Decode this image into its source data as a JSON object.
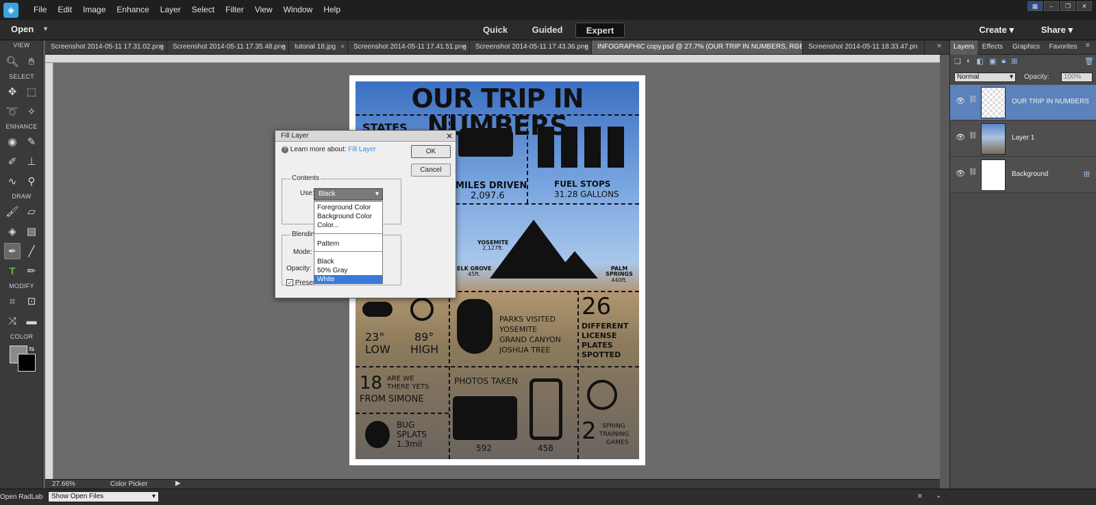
{
  "menubar": {
    "items": [
      "File",
      "Edit",
      "Image",
      "Enhance",
      "Layer",
      "Select",
      "Filter",
      "View",
      "Window",
      "Help"
    ]
  },
  "modebar": {
    "open_label": "Open",
    "modes": [
      "Quick",
      "Guided",
      "Expert"
    ],
    "create_label": "Create",
    "share_label": "Share"
  },
  "toolbox": {
    "sections": [
      "VIEW",
      "SELECT",
      "ENHANCE",
      "DRAW",
      "MODIFY",
      "COLOR"
    ]
  },
  "tabs": [
    "Screenshot 2014-05-11 17.31.02.png",
    "Screenshot 2014-05-11 17.35.48.png",
    "tutorial 18.jpg",
    "Screenshot 2014-05-11 17.41.51.png",
    "Screenshot 2014-05-11 17.43.36.png",
    "INFOGRAPHIC copy.psd @ 27.7% (OUR TRIP IN NUMBERS, RGB/8) *",
    "Screenshot 2014-05-11 18.33.47.pn"
  ],
  "artwork": {
    "title": "OUR TRIP IN NUMBERS",
    "states_label": "STATES",
    "miles_label": "MILES DRIVEN",
    "miles_value": "2,097.6",
    "fuel_label": "FUEL STOPS",
    "fuel_value": "31.28 GALLONS",
    "yosemite": "YOSEMITE",
    "yosemite_elev": "2,127ft.",
    "elk_grove": "ELK GROVE",
    "elk_elev": "45ft.",
    "palm_springs": "PALM SPRINGS",
    "palm_elev": "440ft.",
    "low_temp": "23°",
    "low_label": "LOW",
    "high_temp": "89°",
    "high_label": "HIGH",
    "parks_lines": [
      "PARKS VISITED",
      "YOSEMITE",
      "GRAND CANYON",
      "JOSHUA TREE"
    ],
    "plates_num": "26",
    "plates_lines": [
      "DIFFERENT",
      "LICENSE",
      "PLATES",
      "SPOTTED"
    ],
    "are_we_num": "18",
    "are_we_line1": "ARE WE",
    "are_we_line2": "THERE YETS",
    "are_we_line3": "FROM SIMONE",
    "photos_label": "PHOTOS TAKEN",
    "camera_count": "592",
    "phone_count": "458",
    "bug_lines": [
      "BUG",
      "SPLATS",
      "1.3mil"
    ],
    "spring_num": "2",
    "spring_lines": [
      "SPRING",
      "TRAINING",
      "GAMES"
    ]
  },
  "dialog": {
    "title": "Fill Layer",
    "learn_prefix": "Learn more about:",
    "learn_link": "Fill Layer",
    "ok_label": "OK",
    "cancel_label": "Cancel",
    "contents_label": "Contents",
    "use_label": "Use:",
    "use_value": "Black",
    "blending_label": "Blendin",
    "mode_label": "Mode:",
    "opacity_label": "Opacity:",
    "preserve_label": "Preser",
    "options": [
      "Foreground Color",
      "Background Color",
      "Color...",
      "Pattern",
      "Black",
      "50% Gray",
      "White"
    ],
    "highlighted": "White"
  },
  "layers_panel": {
    "tabs": [
      "Layers",
      "Effects",
      "Graphics",
      "Favorites"
    ],
    "blend_mode": "Normal",
    "opacity_label": "Opacity:",
    "opacity_value": "100%",
    "layers": [
      "OUR TRIP IN NUMBERS",
      "Layer 1",
      "Background"
    ]
  },
  "status": {
    "zoom": "27.66%",
    "tool_name": "Color Picker"
  },
  "bottom": {
    "left_text": "Open RadLab",
    "show_open_files": "Show Open Files"
  },
  "colors": {
    "accent_blue": "#3c78d8",
    "arrow_red": "#d9141c"
  }
}
